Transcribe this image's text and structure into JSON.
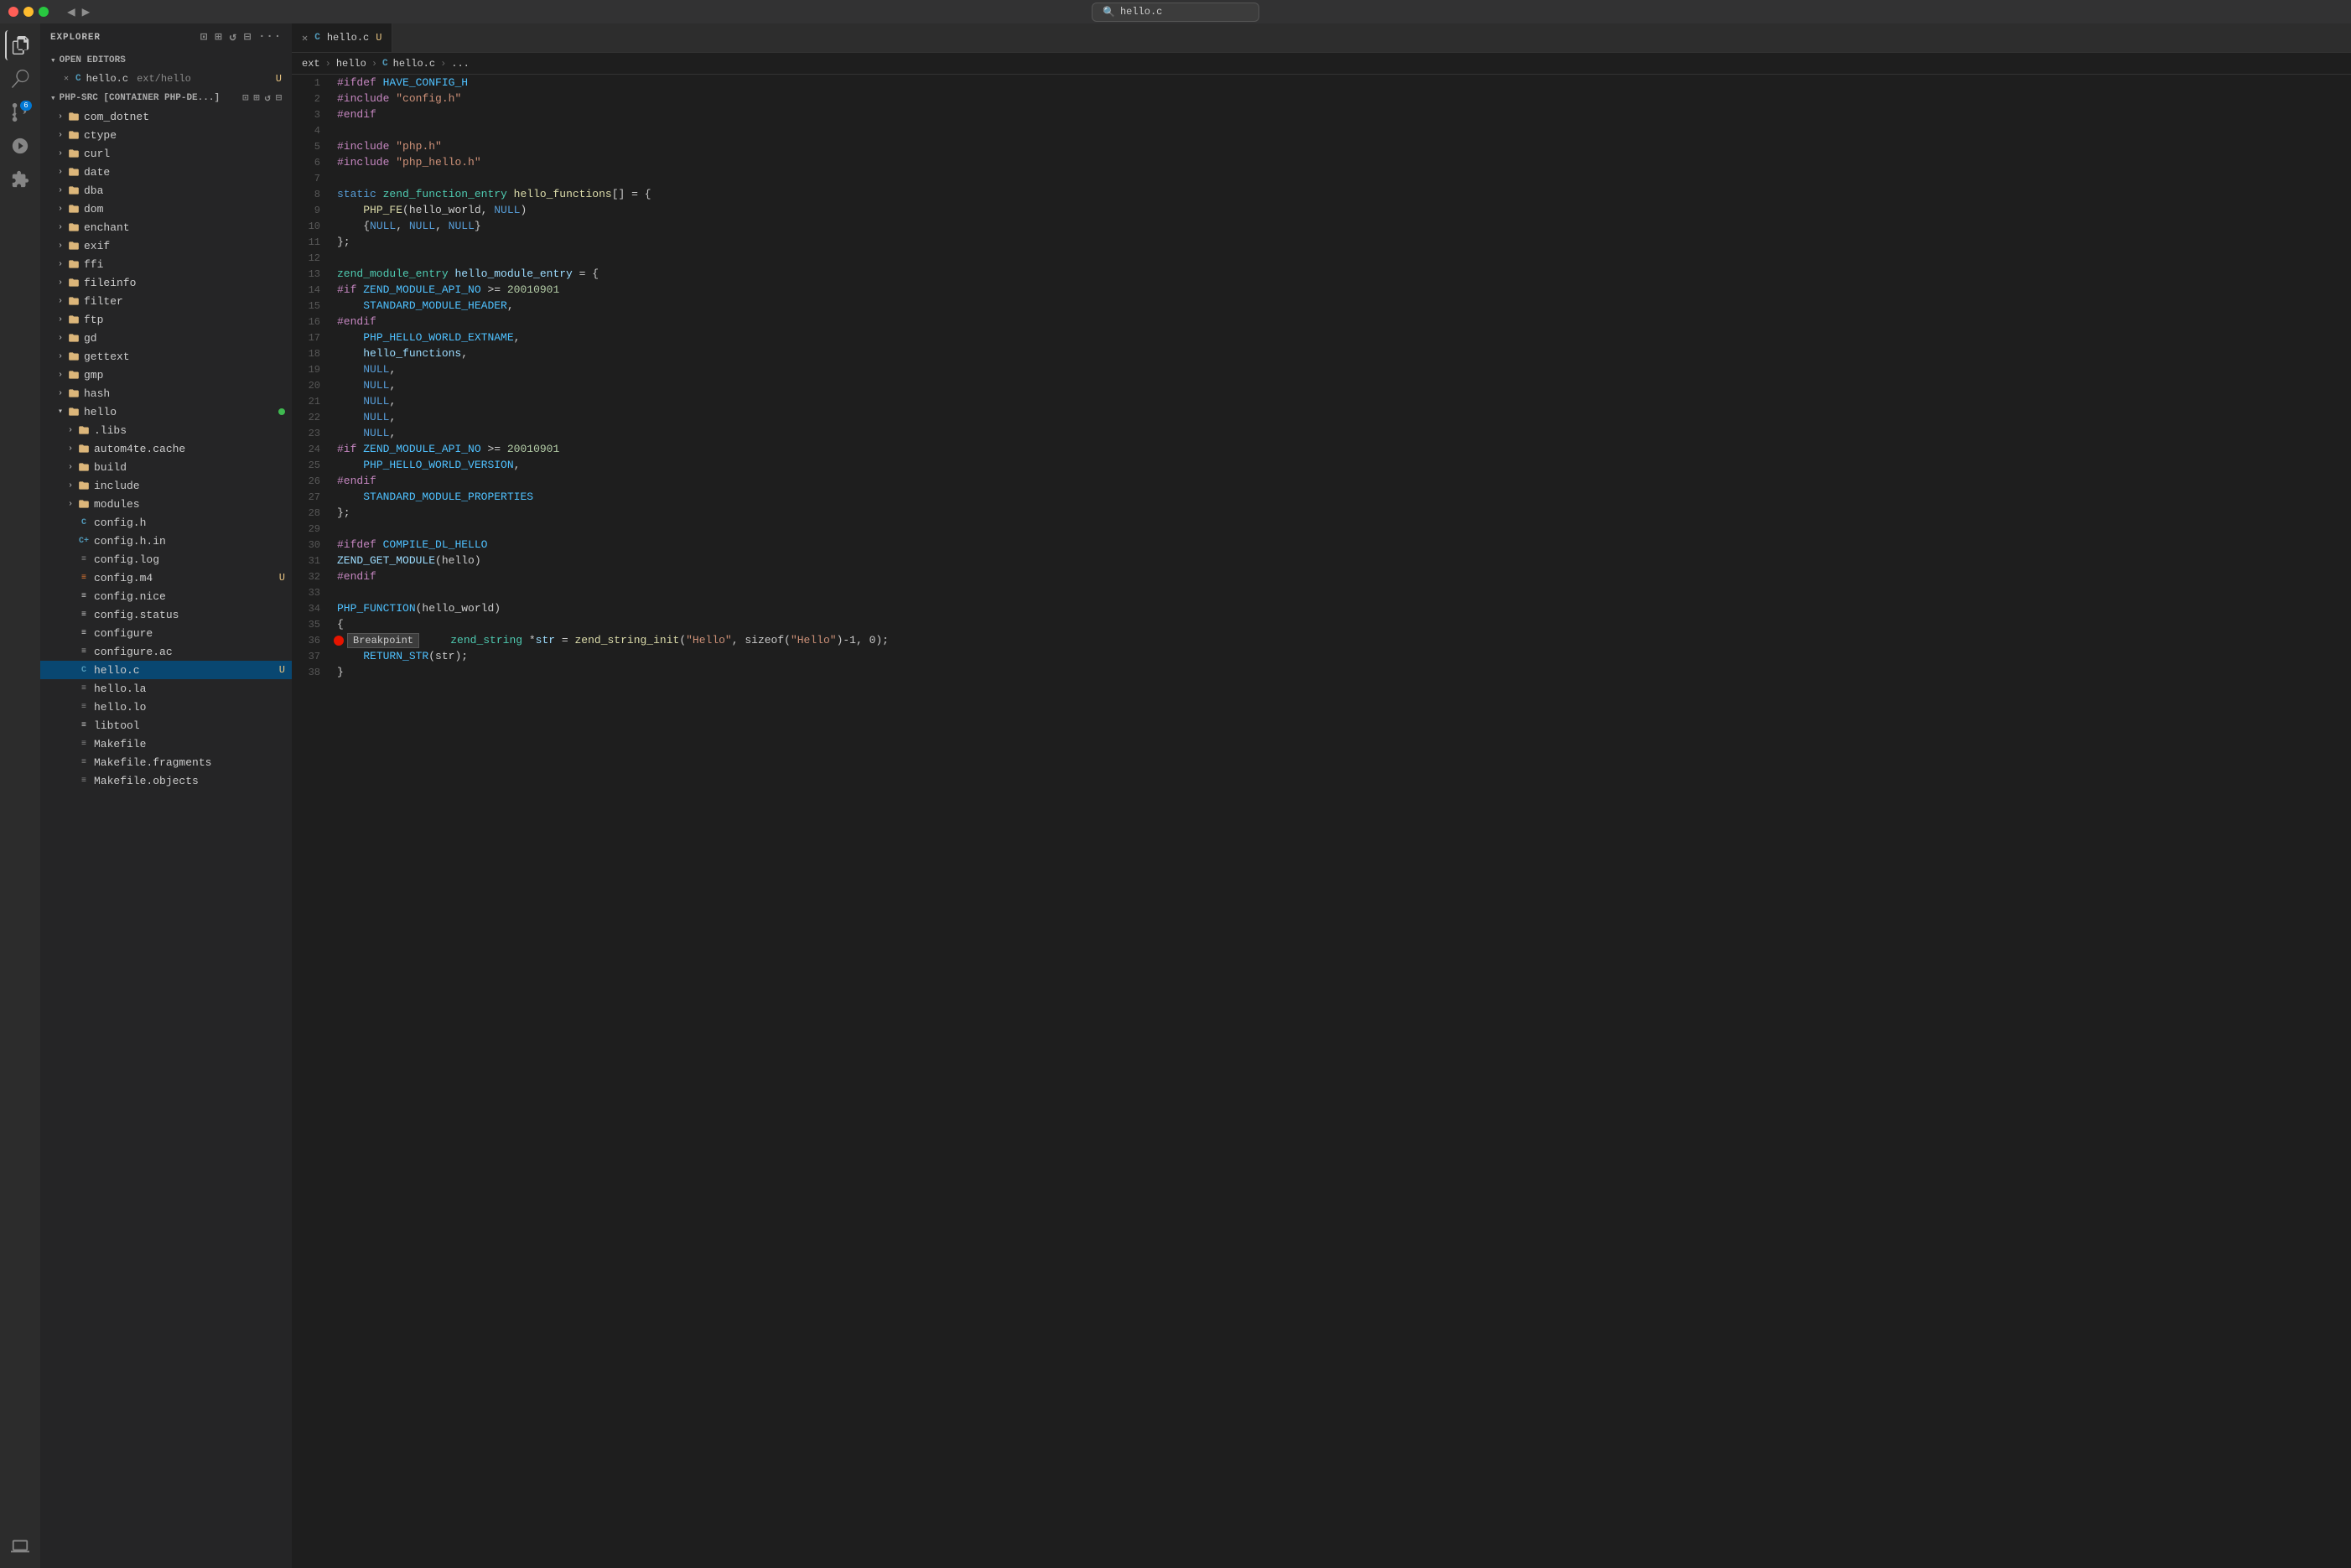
{
  "titlebar": {
    "search_text": "hello.c",
    "back_icon": "◀",
    "forward_icon": "▶",
    "search_placeholder": "hello.c"
  },
  "activity_bar": {
    "icons": [
      {
        "name": "explorer-icon",
        "symbol": "⎘",
        "active": true
      },
      {
        "name": "search-icon",
        "symbol": "🔍",
        "active": false
      },
      {
        "name": "source-control-icon",
        "symbol": "⑂",
        "active": false,
        "badge": "6"
      },
      {
        "name": "run-debug-icon",
        "symbol": "▷",
        "active": false
      },
      {
        "name": "extensions-icon",
        "symbol": "⊞",
        "active": false
      },
      {
        "name": "remote-icon",
        "symbol": "⊡",
        "active": false
      }
    ]
  },
  "sidebar": {
    "title": "EXPLORER",
    "more_icon": "···",
    "sections": {
      "open_editors": {
        "label": "OPEN EDITORS",
        "items": [
          {
            "name": "hello.c",
            "path": "ext/hello",
            "modified": "U",
            "icon": "C",
            "active": true
          }
        ]
      },
      "php_src": {
        "label": "PHP-SRC [CONTAINER PHP-DE...]",
        "folders": [
          {
            "name": "com_dotnet",
            "indent": 1,
            "expanded": false
          },
          {
            "name": "ctype",
            "indent": 1,
            "expanded": false
          },
          {
            "name": "curl",
            "indent": 1,
            "expanded": false
          },
          {
            "name": "date",
            "indent": 1,
            "expanded": false
          },
          {
            "name": "dba",
            "indent": 1,
            "expanded": false
          },
          {
            "name": "dom",
            "indent": 1,
            "expanded": false
          },
          {
            "name": "enchant",
            "indent": 1,
            "expanded": false
          },
          {
            "name": "exif",
            "indent": 1,
            "expanded": false
          },
          {
            "name": "ffi",
            "indent": 1,
            "expanded": false
          },
          {
            "name": "fileinfo",
            "indent": 1,
            "expanded": false
          },
          {
            "name": "filter",
            "indent": 1,
            "expanded": false
          },
          {
            "name": "ftp",
            "indent": 1,
            "expanded": false
          },
          {
            "name": "gd",
            "indent": 1,
            "expanded": false
          },
          {
            "name": "gettext",
            "indent": 1,
            "expanded": false
          },
          {
            "name": "gmp",
            "indent": 1,
            "expanded": false
          },
          {
            "name": "hash",
            "indent": 1,
            "expanded": false
          },
          {
            "name": "hello",
            "indent": 1,
            "expanded": true,
            "has_dot": true
          }
        ],
        "hello_children": [
          {
            "name": ".libs",
            "indent": 2,
            "type": "folder"
          },
          {
            "name": "autom4te.cache",
            "indent": 2,
            "type": "folder"
          },
          {
            "name": "build",
            "indent": 2,
            "type": "folder"
          },
          {
            "name": "include",
            "indent": 2,
            "type": "folder"
          },
          {
            "name": "modules",
            "indent": 2,
            "type": "folder"
          },
          {
            "name": "config.h",
            "indent": 2,
            "type": "file-c"
          },
          {
            "name": "config.h.in",
            "indent": 2,
            "type": "file-ch"
          },
          {
            "name": "config.log",
            "indent": 2,
            "type": "file-log"
          },
          {
            "name": "config.m4",
            "indent": 2,
            "type": "file-m4",
            "modified": "U"
          },
          {
            "name": "config.nice",
            "indent": 2,
            "type": "file-generic"
          },
          {
            "name": "config.status",
            "indent": 2,
            "type": "file-generic"
          },
          {
            "name": "configure",
            "indent": 2,
            "type": "file-generic"
          },
          {
            "name": "configure.ac",
            "indent": 2,
            "type": "file-ac"
          },
          {
            "name": "hello.c",
            "indent": 2,
            "type": "file-c",
            "modified": "U",
            "selected": true
          },
          {
            "name": "hello.la",
            "indent": 2,
            "type": "file-la"
          },
          {
            "name": "hello.lo",
            "indent": 2,
            "type": "file-lo"
          },
          {
            "name": "libtool",
            "indent": 2,
            "type": "file-generic"
          },
          {
            "name": "Makefile",
            "indent": 2,
            "type": "file-mk"
          },
          {
            "name": "Makefile.fragments",
            "indent": 2,
            "type": "file-mk"
          },
          {
            "name": "Makefile.objects",
            "indent": 2,
            "type": "file-mk"
          }
        ]
      }
    }
  },
  "breadcrumb": {
    "items": [
      "ext",
      "hello",
      "hello.c",
      "..."
    ]
  },
  "editor": {
    "filename": "hello.c",
    "tab_label": "hello.c",
    "tab_path": "ext/hello",
    "tab_modified": "U",
    "lines": [
      {
        "num": 1,
        "tokens": [
          {
            "cls": "kw-preprocessor",
            "t": "#ifdef"
          },
          {
            "cls": "",
            "t": " "
          },
          {
            "cls": "kw-macro",
            "t": "HAVE_CONFIG_H"
          }
        ]
      },
      {
        "num": 2,
        "tokens": [
          {
            "cls": "kw-preprocessor",
            "t": "#include"
          },
          {
            "cls": "",
            "t": " "
          },
          {
            "cls": "kw-string",
            "t": "\"config.h\""
          }
        ]
      },
      {
        "num": 3,
        "tokens": [
          {
            "cls": "kw-preprocessor",
            "t": "#endif"
          }
        ]
      },
      {
        "num": 4,
        "tokens": []
      },
      {
        "num": 5,
        "tokens": [
          {
            "cls": "kw-preprocessor",
            "t": "#include"
          },
          {
            "cls": "",
            "t": " "
          },
          {
            "cls": "kw-string",
            "t": "\"php.h\""
          }
        ]
      },
      {
        "num": 6,
        "tokens": [
          {
            "cls": "kw-preprocessor",
            "t": "#include"
          },
          {
            "cls": "",
            "t": " "
          },
          {
            "cls": "kw-string",
            "t": "\"php_hello.h\""
          }
        ]
      },
      {
        "num": 7,
        "tokens": []
      },
      {
        "num": 8,
        "tokens": [
          {
            "cls": "kw-static",
            "t": "static"
          },
          {
            "cls": "",
            "t": " "
          },
          {
            "cls": "kw-type",
            "t": "zend_function_entry"
          },
          {
            "cls": "",
            "t": " "
          },
          {
            "cls": "kw-function",
            "t": "hello_functions"
          },
          {
            "cls": "",
            "t": "[] = {"
          }
        ]
      },
      {
        "num": 9,
        "tokens": [
          {
            "cls": "",
            "t": "    "
          },
          {
            "cls": "kw-function",
            "t": "PHP_FE"
          },
          {
            "cls": "",
            "t": "(hello_world, "
          },
          {
            "cls": "kw-null",
            "t": "NULL"
          },
          {
            "cls": "",
            "t": ")"
          }
        ]
      },
      {
        "num": 10,
        "tokens": [
          {
            "cls": "",
            "t": "    {"
          },
          {
            "cls": "kw-null",
            "t": "NULL"
          },
          {
            "cls": "",
            "t": ", "
          },
          {
            "cls": "kw-null",
            "t": "NULL"
          },
          {
            "cls": "",
            "t": ", "
          },
          {
            "cls": "kw-null",
            "t": "NULL"
          },
          {
            "cls": "",
            "t": "}"
          }
        ]
      },
      {
        "num": 11,
        "tokens": [
          {
            "cls": "",
            "t": "};"
          }
        ]
      },
      {
        "num": 12,
        "tokens": []
      },
      {
        "num": 13,
        "tokens": [
          {
            "cls": "kw-type",
            "t": "zend_module_entry"
          },
          {
            "cls": "",
            "t": " "
          },
          {
            "cls": "kw-variable",
            "t": "hello_module_entry"
          },
          {
            "cls": "",
            "t": " = {"
          }
        ]
      },
      {
        "num": 14,
        "tokens": [
          {
            "cls": "kw-preprocessor",
            "t": "#if"
          },
          {
            "cls": "",
            "t": " "
          },
          {
            "cls": "kw-macro",
            "t": "ZEND_MODULE_API_NO"
          },
          {
            "cls": "",
            "t": " >= "
          },
          {
            "cls": "kw-number",
            "t": "20010901"
          }
        ]
      },
      {
        "num": 15,
        "tokens": [
          {
            "cls": "",
            "t": "    "
          },
          {
            "cls": "kw-macro",
            "t": "STANDARD_MODULE_HEADER"
          },
          {
            "cls": "",
            "t": ","
          }
        ]
      },
      {
        "num": 16,
        "tokens": [
          {
            "cls": "kw-preprocessor",
            "t": "#endif"
          }
        ]
      },
      {
        "num": 17,
        "tokens": [
          {
            "cls": "",
            "t": "    "
          },
          {
            "cls": "kw-macro",
            "t": "PHP_HELLO_WORLD_EXTNAME"
          },
          {
            "cls": "",
            "t": ","
          }
        ]
      },
      {
        "num": 18,
        "tokens": [
          {
            "cls": "",
            "t": "    "
          },
          {
            "cls": "kw-variable",
            "t": "hello_functions"
          },
          {
            "cls": "",
            "t": ","
          }
        ]
      },
      {
        "num": 19,
        "tokens": [
          {
            "cls": "",
            "t": "    "
          },
          {
            "cls": "kw-null",
            "t": "NULL"
          },
          {
            "cls": "",
            "t": ","
          }
        ]
      },
      {
        "num": 20,
        "tokens": [
          {
            "cls": "",
            "t": "    "
          },
          {
            "cls": "kw-null",
            "t": "NULL"
          },
          {
            "cls": "",
            "t": ","
          }
        ]
      },
      {
        "num": 21,
        "tokens": [
          {
            "cls": "",
            "t": "    "
          },
          {
            "cls": "kw-null",
            "t": "NULL"
          },
          {
            "cls": "",
            "t": ","
          }
        ]
      },
      {
        "num": 22,
        "tokens": [
          {
            "cls": "",
            "t": "    "
          },
          {
            "cls": "kw-null",
            "t": "NULL"
          },
          {
            "cls": "",
            "t": ","
          }
        ]
      },
      {
        "num": 23,
        "tokens": [
          {
            "cls": "",
            "t": "    "
          },
          {
            "cls": "kw-null",
            "t": "NULL"
          },
          {
            "cls": "",
            "t": ","
          }
        ]
      },
      {
        "num": 24,
        "tokens": [
          {
            "cls": "kw-preprocessor",
            "t": "#if"
          },
          {
            "cls": "",
            "t": " "
          },
          {
            "cls": "kw-macro",
            "t": "ZEND_MODULE_API_NO"
          },
          {
            "cls": "",
            "t": " >= "
          },
          {
            "cls": "kw-number",
            "t": "20010901"
          }
        ]
      },
      {
        "num": 25,
        "tokens": [
          {
            "cls": "",
            "t": "    "
          },
          {
            "cls": "kw-macro",
            "t": "PHP_HELLO_WORLD_VERSION"
          },
          {
            "cls": "",
            "t": ","
          }
        ]
      },
      {
        "num": 26,
        "tokens": [
          {
            "cls": "kw-preprocessor",
            "t": "#endif"
          }
        ]
      },
      {
        "num": 27,
        "tokens": [
          {
            "cls": "",
            "t": "    "
          },
          {
            "cls": "kw-macro",
            "t": "STANDARD_MODULE_PROPERTIES"
          }
        ]
      },
      {
        "num": 28,
        "tokens": [
          {
            "cls": "",
            "t": "};"
          }
        ]
      },
      {
        "num": 29,
        "tokens": []
      },
      {
        "num": 30,
        "tokens": [
          {
            "cls": "kw-preprocessor",
            "t": "#ifdef"
          },
          {
            "cls": "",
            "t": " "
          },
          {
            "cls": "kw-macro",
            "t": "COMPILE_DL_HELLO"
          }
        ]
      },
      {
        "num": 31,
        "tokens": [
          {
            "cls": "kw-variable",
            "t": "ZEND_GET_MODULE"
          },
          {
            "cls": "",
            "t": "(hello)"
          }
        ]
      },
      {
        "num": 32,
        "tokens": [
          {
            "cls": "kw-preprocessor",
            "t": "#endif"
          }
        ]
      },
      {
        "num": 33,
        "tokens": []
      },
      {
        "num": 34,
        "tokens": [
          {
            "cls": "kw-macro",
            "t": "PHP_FUNCTION"
          },
          {
            "cls": "",
            "t": "(hello_world)"
          }
        ]
      },
      {
        "num": 35,
        "tokens": [
          {
            "cls": "",
            "t": "{"
          }
        ]
      },
      {
        "num": 36,
        "tokens": [
          {
            "cls": "",
            "t": "    "
          },
          {
            "cls": "kw-type",
            "t": "zend_string"
          },
          {
            "cls": "",
            "t": " *"
          },
          {
            "cls": "kw-variable",
            "t": "str"
          },
          {
            "cls": "",
            "t": " = "
          },
          {
            "cls": "kw-function",
            "t": "zend_string_init"
          },
          {
            "cls": "",
            "t": "("
          },
          {
            "cls": "kw-string",
            "t": "\"Hello\""
          },
          {
            "cls": "",
            "t": ", sizeof("
          },
          {
            "cls": "kw-string",
            "t": "\"Hello\""
          },
          {
            "cls": "",
            "t": ")-1, 0);"
          },
          {
            "cls": "kw-comment",
            "t": ""
          }
        ],
        "breakpoint": true,
        "breakpoint_label": "Breakpoint"
      },
      {
        "num": 37,
        "tokens": [
          {
            "cls": "",
            "t": "    "
          },
          {
            "cls": "kw-macro",
            "t": "RETURN_STR"
          },
          {
            "cls": "",
            "t": "(str);"
          }
        ]
      },
      {
        "num": 38,
        "tokens": [
          {
            "cls": "",
            "t": "}"
          }
        ]
      }
    ]
  }
}
